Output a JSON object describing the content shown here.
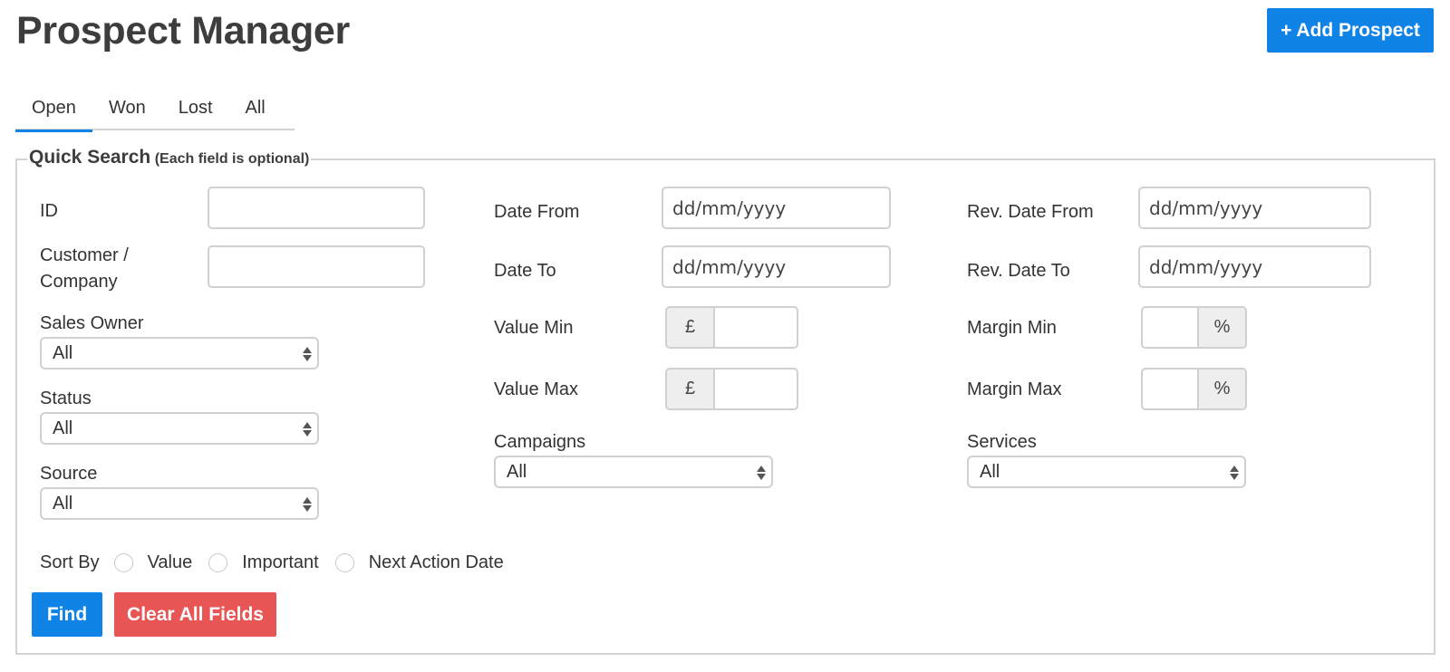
{
  "header": {
    "title": "Prospect Manager",
    "add_button_label": "+ Add Prospect"
  },
  "tabs": [
    {
      "label": "Open",
      "active": true
    },
    {
      "label": "Won",
      "active": false
    },
    {
      "label": "Lost",
      "active": false
    },
    {
      "label": "All",
      "active": false
    }
  ],
  "quick_search": {
    "legend": "Quick Search",
    "legend_note": "(Each field is optional)",
    "fields": {
      "id": {
        "label": "ID",
        "value": ""
      },
      "customer": {
        "label_line1": "Customer /",
        "label_line2": "Company",
        "value": ""
      },
      "sales_owner": {
        "label": "Sales Owner",
        "selected": "All"
      },
      "status": {
        "label": "Status",
        "selected": "All"
      },
      "source": {
        "label": "Source",
        "selected": "All"
      },
      "date_from": {
        "label": "Date From",
        "placeholder": "dd/mm/yyyy"
      },
      "date_to": {
        "label": "Date To",
        "placeholder": "dd/mm/yyyy"
      },
      "value_min": {
        "label": "Value Min",
        "prefix": "£",
        "value": ""
      },
      "value_max": {
        "label": "Value Max",
        "prefix": "£",
        "value": ""
      },
      "campaigns": {
        "label": "Campaigns",
        "selected": "All"
      },
      "rev_date_from": {
        "label": "Rev. Date From",
        "placeholder": "dd/mm/yyyy"
      },
      "rev_date_to": {
        "label": "Rev. Date To",
        "placeholder": "dd/mm/yyyy"
      },
      "margin_min": {
        "label": "Margin Min",
        "suffix": "%",
        "value": ""
      },
      "margin_max": {
        "label": "Margin Max",
        "suffix": "%",
        "value": ""
      },
      "services": {
        "label": "Services",
        "selected": "All"
      }
    },
    "sort_by": {
      "label": "Sort By",
      "options": [
        "Value",
        "Important",
        "Next Action Date"
      ]
    },
    "find_label": "Find",
    "clear_label": "Clear All Fields"
  },
  "colors": {
    "primary": "#1083e6",
    "danger": "#e85555",
    "border": "#d4d4d4"
  }
}
